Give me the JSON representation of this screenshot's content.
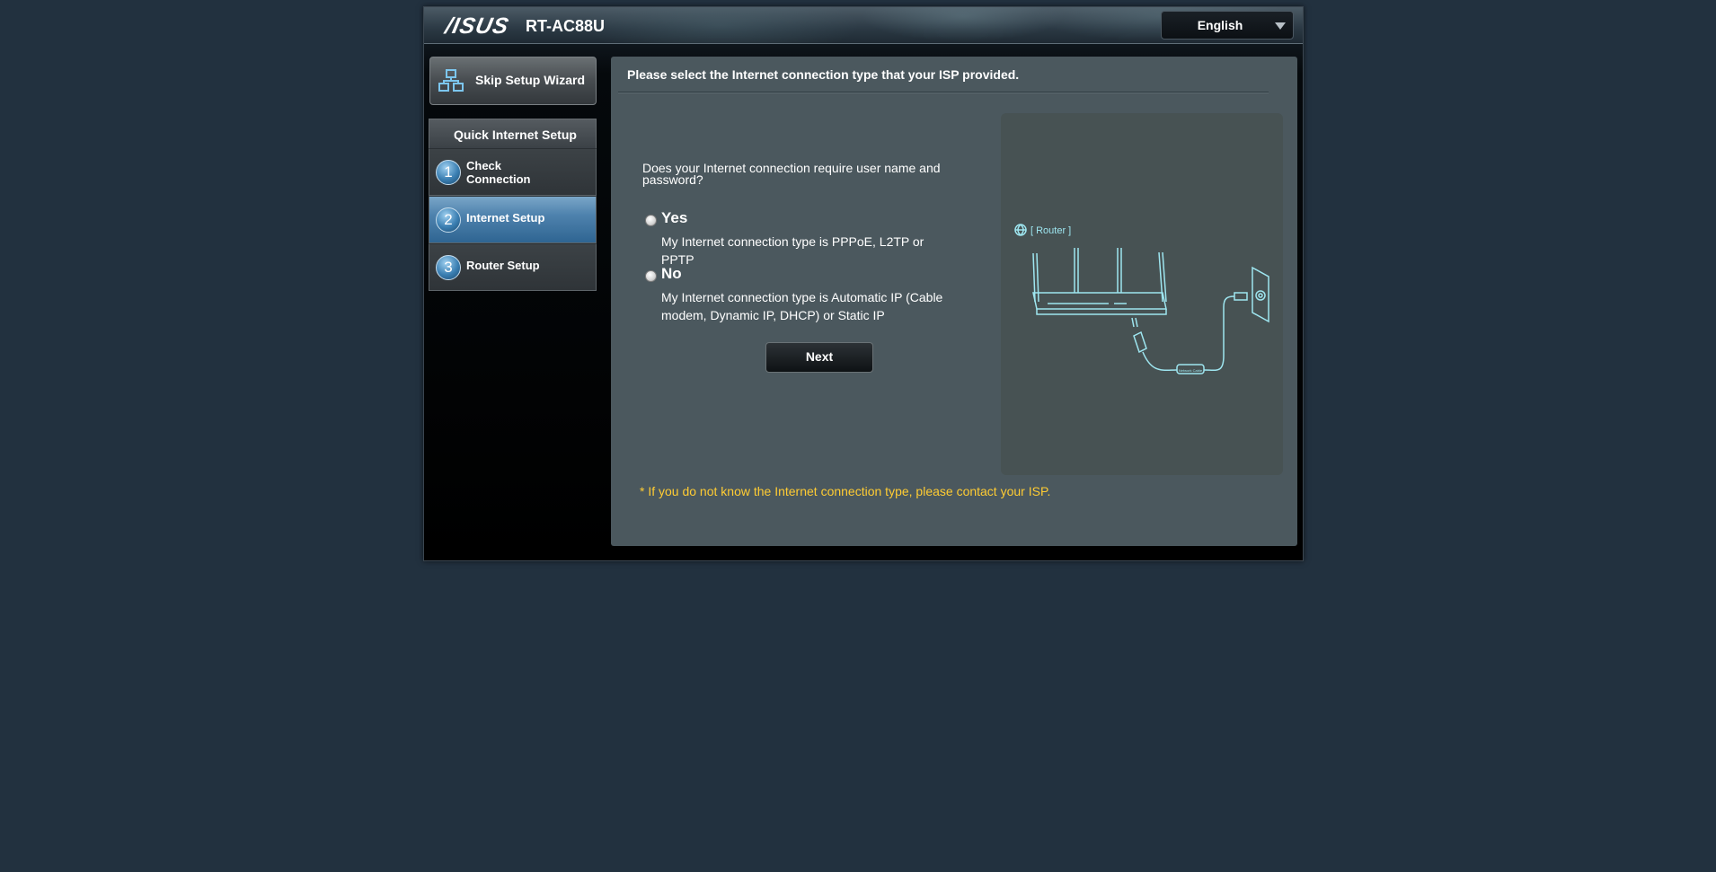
{
  "header": {
    "brand": "/ISUS",
    "model": "RT-AC88U",
    "language": {
      "selected": "English"
    }
  },
  "sidebar": {
    "skip_label": "Skip Setup Wizard",
    "steps_title": "Quick Internet Setup",
    "steps": [
      {
        "number": "1",
        "label": "Check Connection",
        "active": false
      },
      {
        "number": "2",
        "label": "Internet Setup",
        "active": true
      },
      {
        "number": "3",
        "label": "Router Setup",
        "active": false
      }
    ]
  },
  "main": {
    "title": "Please select the Internet connection type that your ISP provided.",
    "question": "Does your Internet connection require user name and password?",
    "options": [
      {
        "title": "Yes",
        "description": "My Internet connection type is PPPoE, L2TP or PPTP",
        "selected": false
      },
      {
        "title": "No",
        "description": "My Internet connection type is Automatic IP (Cable modem, Dynamic IP, DHCP) or Static IP",
        "selected": false
      }
    ],
    "next_label": "Next",
    "note": "* If you do not know the Internet connection type, please contact your ISP."
  },
  "illustration": {
    "router_label": "[ Router ]",
    "cable_label": "Network Cable"
  },
  "colors": {
    "background": "#22313f",
    "content_panel": "#4b585e",
    "active_step": "#4e82ad",
    "note": "#ffcc33",
    "illustration_line": "#9ee6f0"
  }
}
